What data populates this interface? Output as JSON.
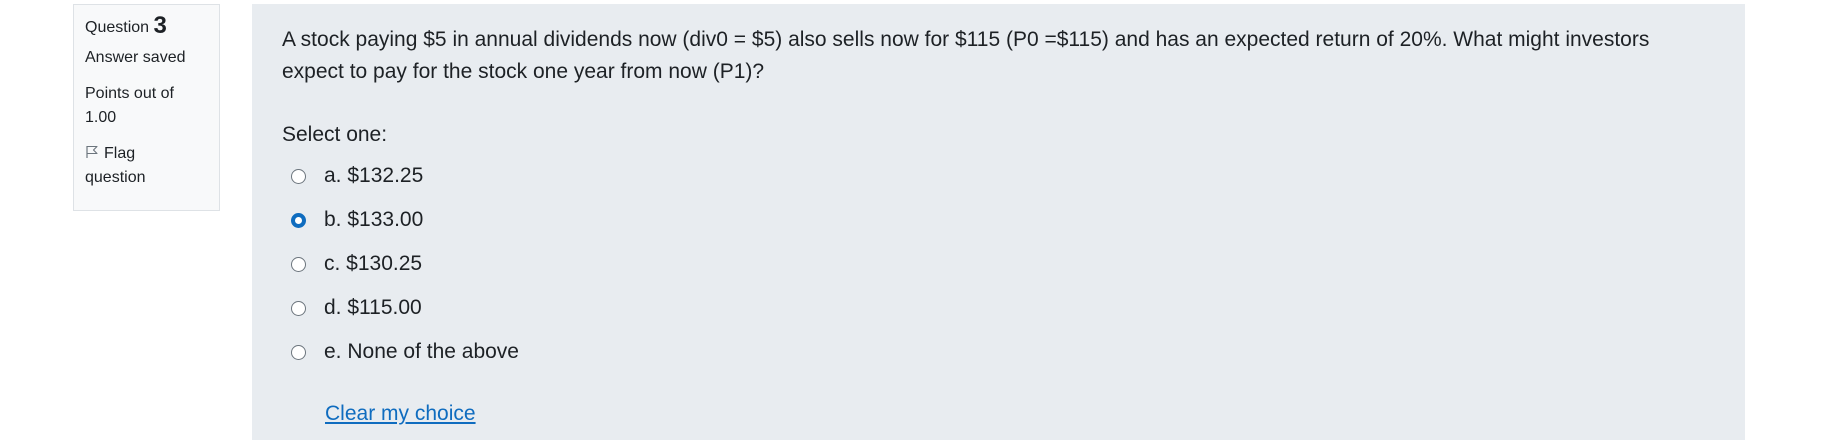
{
  "info": {
    "question_label": "Question",
    "question_number": "3",
    "state": "Answer saved",
    "grade_line1": "Points out of",
    "grade_line2": "1.00",
    "flag_label_line1": "Flag",
    "flag_label_line2": "question",
    "flag_icon": "flag-icon"
  },
  "question": {
    "text": "A stock paying $5 in annual dividends now (div0 = $5) also sells now for $115 (P0 =$115) and has an expected return of 20%. What might investors expect to pay for the stock one year from now (P1)?",
    "prompt": "Select one:",
    "answers": [
      {
        "label": "a. $132.25",
        "selected": false
      },
      {
        "label": "b. $133.00",
        "selected": true
      },
      {
        "label": "c. $130.25",
        "selected": false
      },
      {
        "label": "d. $115.00",
        "selected": false
      },
      {
        "label": "e. None of the above",
        "selected": false
      }
    ],
    "clear_label": "Clear my choice"
  },
  "colors": {
    "accent": "#0f6cbf",
    "content_bg": "#e8ecf0",
    "info_bg": "#f8f9fa"
  }
}
